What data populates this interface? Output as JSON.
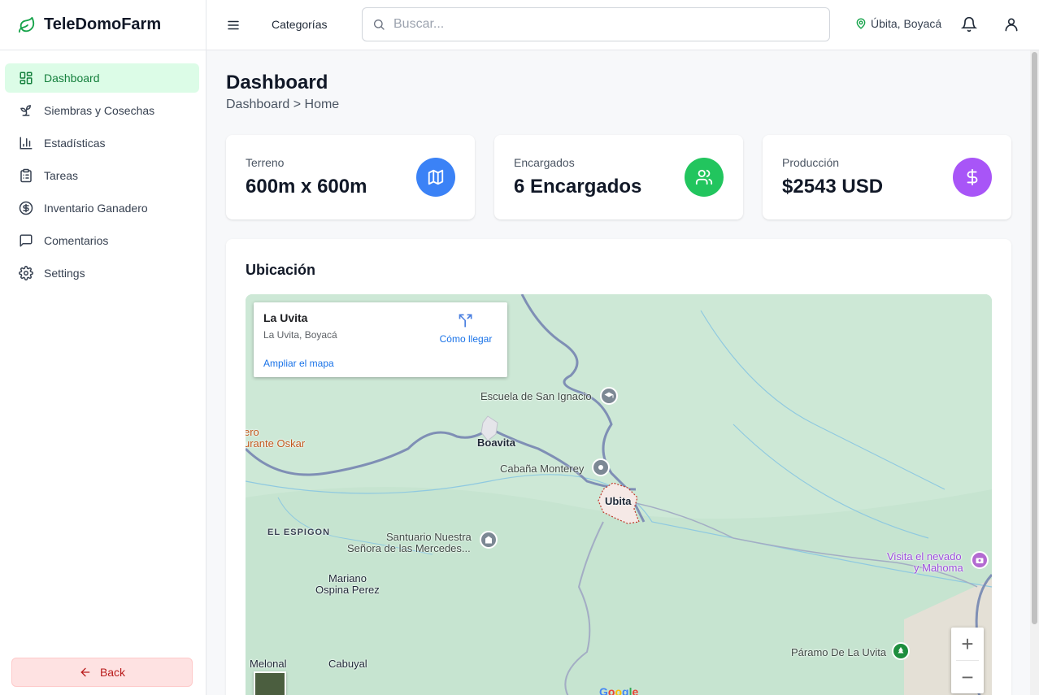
{
  "brand": {
    "name": "TeleDomoFarm",
    "icon": "leaf-icon",
    "color": "#16a34a"
  },
  "sidebar": {
    "items": [
      {
        "label": "Dashboard",
        "icon": "grid-icon",
        "active": true
      },
      {
        "label": "Siembras y Cosechas",
        "icon": "sprout-icon",
        "active": false
      },
      {
        "label": "Estadísticas",
        "icon": "bar-chart-icon",
        "active": false
      },
      {
        "label": "Tareas",
        "icon": "clipboard-icon",
        "active": false
      },
      {
        "label": "Inventario Ganadero",
        "icon": "dollar-circle-icon",
        "active": false
      },
      {
        "label": "Comentarios",
        "icon": "message-icon",
        "active": false
      },
      {
        "label": "Settings",
        "icon": "gear-icon",
        "active": false
      }
    ],
    "back_label": "Back"
  },
  "topbar": {
    "categories_label": "Categorías",
    "search_placeholder": "Buscar...",
    "search_value": "",
    "location": "Úbita, Boyacá"
  },
  "page": {
    "title": "Dashboard",
    "breadcrumb": "Dashboard > Home"
  },
  "stats": [
    {
      "label": "Terreno",
      "value": "600m x 600m",
      "icon": "map-icon",
      "color": "#3b82f6"
    },
    {
      "label": "Encargados",
      "value": "6 Encargados",
      "icon": "users-icon",
      "color": "#22c55e"
    },
    {
      "label": "Producción",
      "value": "$2543 USD",
      "icon": "dollar-icon",
      "color": "#a855f7"
    }
  ],
  "map_section": {
    "title": "Ubicación",
    "info": {
      "name": "La Uvita",
      "address": "La Uvita, Boyacá",
      "directions_label": "Cómo llegar",
      "expand_label": "Ampliar el mapa"
    },
    "labels": {
      "escuela": "Escuela de San Ignacio",
      "boavita": "Boavita",
      "cabana": "Cabaña Monterey",
      "ubita": "Ubita",
      "espigon": "EL ESPIGON",
      "santuario_1": "Santuario Nuestra",
      "santuario_2": "Señora de las Mercedes...",
      "mariano_1": "Mariano",
      "mariano_2": "Ospina Perez",
      "visita_1": "Visita el nevado",
      "visita_2": "y Mahoma",
      "paramo": "Páramo De La Uvita",
      "melonal": "Melonal",
      "cabuyal": "Cabuyal",
      "oskar_1": "ero",
      "oskar_2": "urante Oskar",
      "google": "Google"
    },
    "zoom_in": "+",
    "zoom_out": "−"
  }
}
